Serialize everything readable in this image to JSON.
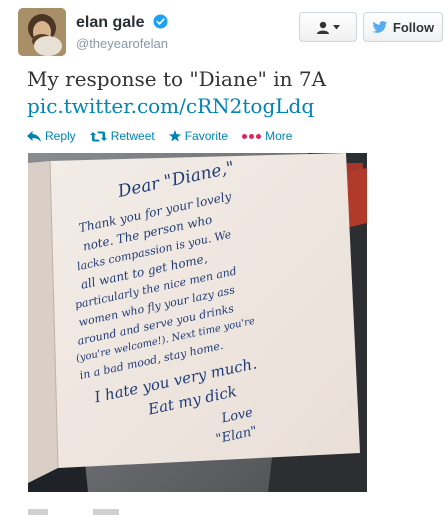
{
  "user": {
    "name": "elan gale",
    "handle": "@theyearofelan",
    "verified": true
  },
  "follow_button": {
    "label": "Follow"
  },
  "tweet": {
    "text": "My response to \"Diane\" in 7A",
    "link": "pic.twitter.com/cRN2togLdq"
  },
  "actions": {
    "reply": "Reply",
    "retweet": "Retweet",
    "favorite": "Favorite",
    "more": "More"
  },
  "note": {
    "lines": [
      "Dear \"Diane,\"",
      "Thank you for your lovely",
      "note. The person who",
      "lacks compassion is you. We",
      "all want to get home,",
      "particularly the nice men and",
      "women who fly your lazy ass",
      "around and serve you drinks",
      "(you're welcome!). Next time you're",
      "in a bad mood, stay home.",
      "I hate you very much.",
      "Eat my dick",
      "Love",
      "\"Elan\""
    ]
  },
  "colors": {
    "link": "#0084b4",
    "verified": "#1da1f2",
    "more_dots": "#e0245e"
  }
}
